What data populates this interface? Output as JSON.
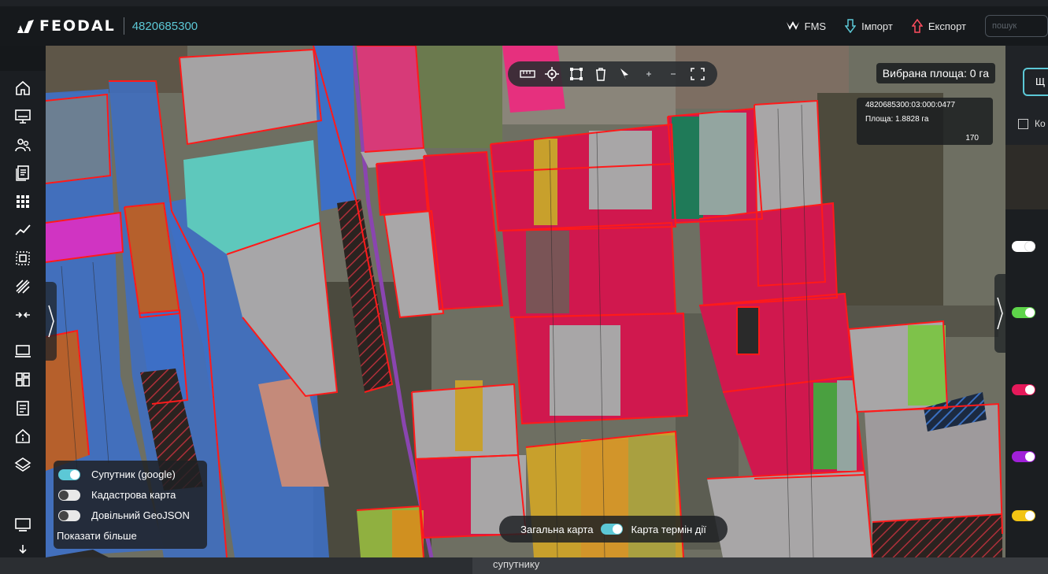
{
  "header": {
    "logo_text": "FEODAL",
    "company_code": "4820685300",
    "fms_label": "FMS",
    "import_label": "Імпорт",
    "export_label": "Експорт",
    "search_placeholder": "пошук"
  },
  "sidebar": {
    "icons": [
      "home-icon",
      "monitor-icon",
      "users-icon",
      "documents-icon",
      "grid-icon",
      "chart-line-icon",
      "select-area-icon",
      "hatch-icon",
      "merge-icon",
      "laptop-icon",
      "dashboard-icon",
      "list-icon",
      "building-icon",
      "layers-icon",
      "screen-icon",
      "download-icon"
    ]
  },
  "map": {
    "selected_area": "Вибрана площа: 0 га",
    "parcel": {
      "cadastre": "4820685300:03:000:0477",
      "area": "Площа: 1.8828 га",
      "number": "170"
    },
    "toolbar": [
      "ruler-icon",
      "locate-icon",
      "polygon-select-icon",
      "trash-icon",
      "pointer-icon",
      "zoom-in-icon",
      "zoom-out-icon",
      "fullscreen-icon"
    ],
    "layers": [
      {
        "label": "Супутник (google)",
        "on": true
      },
      {
        "label": "Кадастрова карта",
        "on": false
      },
      {
        "label": "Довільний GeoJSON",
        "on": false
      }
    ],
    "show_more": "Показати більше",
    "mode_left": "Загальна карта",
    "mode_right": "Карта термін дії"
  },
  "right_panel": {
    "button_label": "Щ",
    "checkbox_label": "Ко",
    "toggles": [
      {
        "color": "#ffffff"
      },
      {
        "color": "#5ed44a"
      },
      {
        "color": "#e6195a"
      },
      {
        "color": "#a020d8"
      },
      {
        "color": "#f2c414"
      }
    ]
  },
  "bottom": {
    "text": "супутнику"
  },
  "colors": {
    "accent": "#5cc8d6",
    "boundary": "#ff1a1a"
  }
}
